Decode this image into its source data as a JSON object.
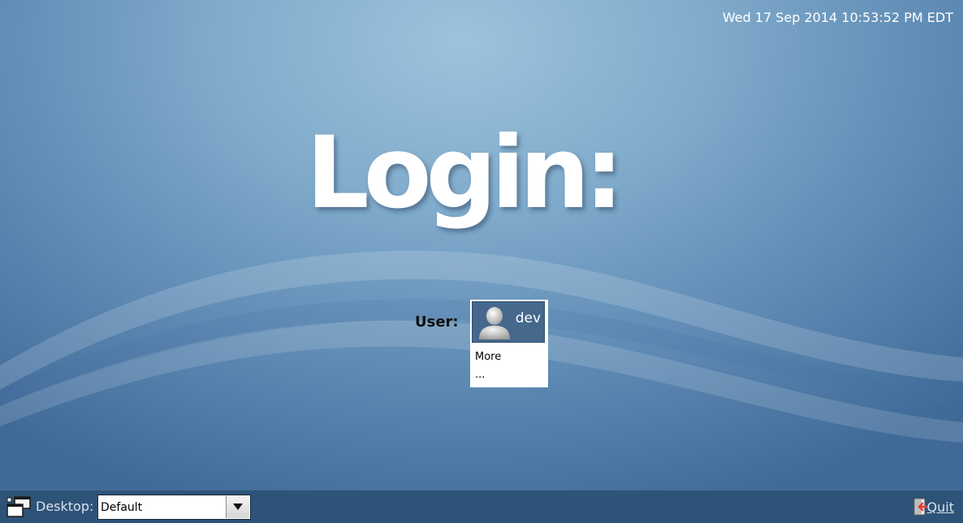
{
  "header": {
    "datetime": "Wed 17 Sep 2014 10:53:52 PM EDT"
  },
  "main": {
    "title": "Login:",
    "user_label": "User:",
    "users": [
      {
        "name": "dev",
        "icon": "user-avatar-icon",
        "selected": true
      }
    ],
    "more_label": "More ..."
  },
  "bottom_bar": {
    "session_icon": "session-windows-icon",
    "desktop_label": "Desktop:",
    "desktop_value": "Default",
    "quit_label": "Quit",
    "quit_icon": "exit-door-icon"
  },
  "colors": {
    "background": "#7faacb",
    "bottom_bar": "#2e5379",
    "selected_user": "#45688c",
    "quit_arrow": "#e53b2f"
  }
}
